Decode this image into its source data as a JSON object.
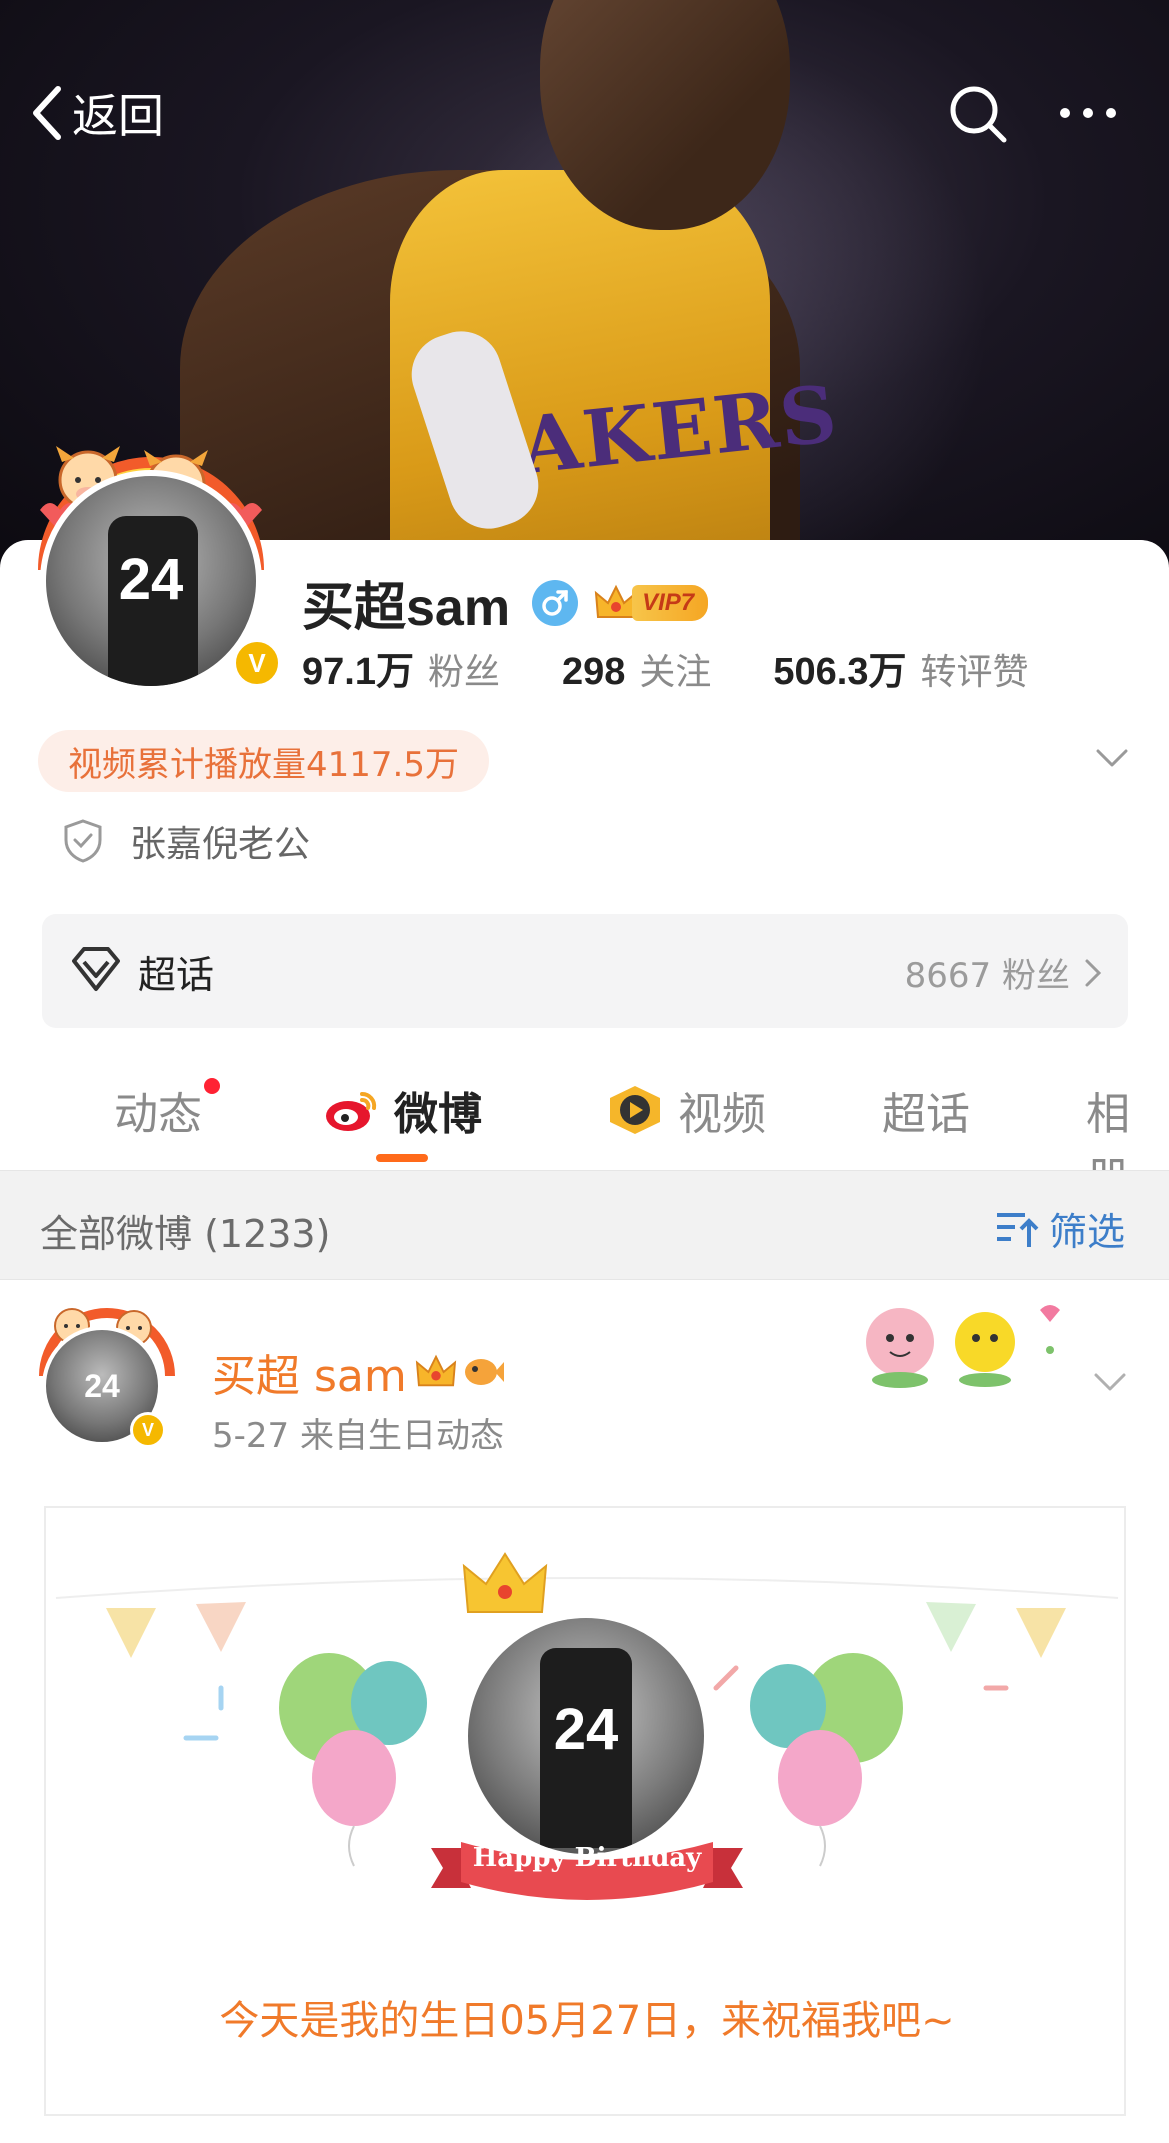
{
  "header": {
    "back_label": "返回"
  },
  "cover": {
    "jersey_text": "AKERS"
  },
  "profile": {
    "name": "买超sam",
    "vip_level": "VIP7",
    "avatar_number": "24",
    "verified_mark": "V",
    "stats": [
      {
        "value": "97.1万",
        "label": "粉丝"
      },
      {
        "value": "298",
        "label": "关注"
      },
      {
        "value": "506.3万",
        "label": "转评赞"
      }
    ],
    "play_count": "视频累计播放量4117.5万",
    "verification": "张嘉倪老公"
  },
  "chaohua_card": {
    "label": "超话",
    "fans": "8667 粉丝"
  },
  "tabs": [
    {
      "label": "动态"
    },
    {
      "label": "微博"
    },
    {
      "label": "视频"
    },
    {
      "label": "超话"
    },
    {
      "label": "相册"
    }
  ],
  "filter_bar": {
    "count_label": "全部微博 (1233)",
    "filter_label": "筛选"
  },
  "post": {
    "author": "买超 sam",
    "meta": "5-27  来自生日动态",
    "avatar_number": "24",
    "card": {
      "avatar_number": "24",
      "banner_text": "Happy Birthday",
      "message": "今天是我的生日05月27日，来祝福我吧~"
    }
  },
  "colors": {
    "accent_orange": "#f07a2a",
    "tab_underline": "#ff6a1a",
    "filter_blue": "#3d7ec9",
    "vip_gold": "#f5b800"
  }
}
